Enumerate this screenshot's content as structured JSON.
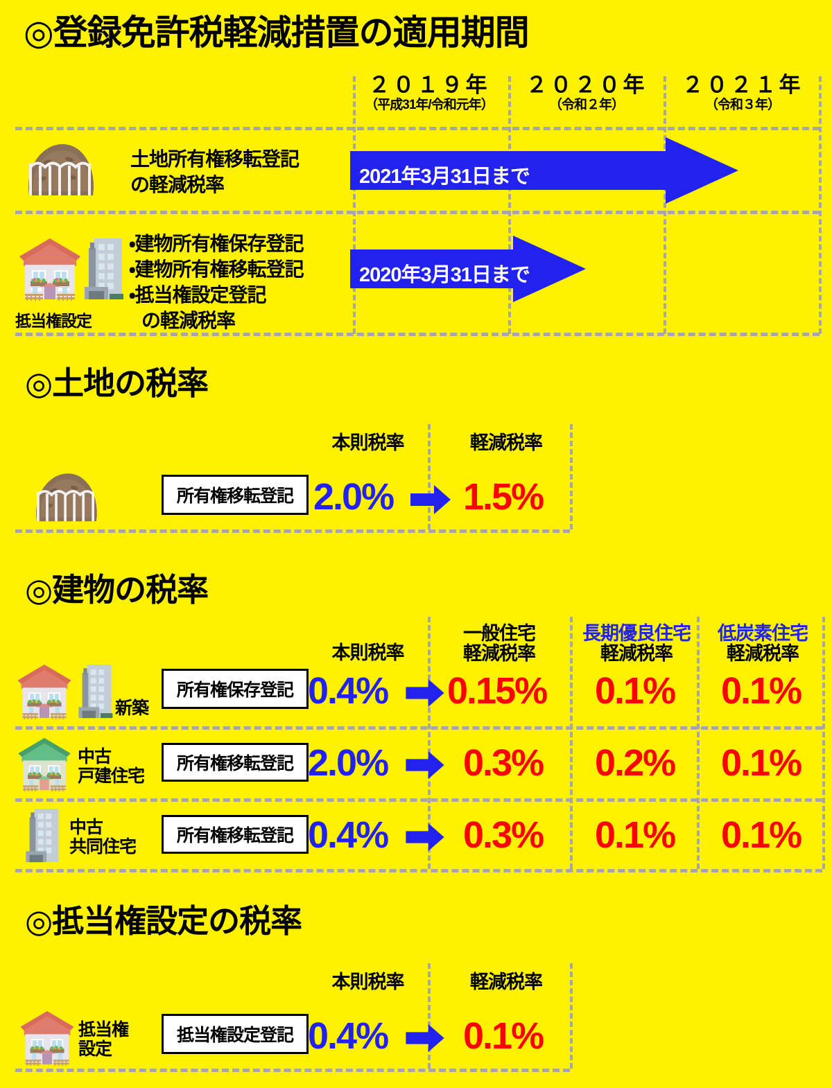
{
  "colors": {
    "background": "#FFF200",
    "arrow_blue": "#2222EE",
    "rate_red": "#FF0000",
    "divider_gray": "#A6A6A6",
    "text_black": "#000000"
  },
  "timeline": {
    "title": "◎登録免許税軽減措置の適用期間",
    "years": [
      {
        "year": "２０１９年",
        "era": "（平成31年/令和元年）"
      },
      {
        "year": "２０２０年",
        "era": "（令和２年）"
      },
      {
        "year": "２０２１年",
        "era": "（令和３年）"
      }
    ],
    "rows": [
      {
        "icon": "land-mound-icon",
        "label_line1": "土地所有権移転登記",
        "label_line2": "の軽減税率",
        "arrow_text": "2021年3月31日まで"
      },
      {
        "icon": "house-and-building-icon",
        "icon_caption": "抵当権設定",
        "bullets": [
          "・建物所有権保存登記",
          "・建物所有権移転登記",
          "・抵当権設定登記"
        ],
        "label_line2": "の軽減税率",
        "arrow_text": "2020年3月31日まで"
      }
    ]
  },
  "land": {
    "title": "◎土地の税率",
    "headers": {
      "standard": "本則税率",
      "reduced": "軽減税率"
    },
    "row": {
      "icon": "land-mound-icon",
      "registration": "所有権移転登記",
      "standard_rate": "2.0%",
      "reduced_rate": "1.5%"
    }
  },
  "building": {
    "title": "◎建物の税率",
    "headers": {
      "standard": "本則税率",
      "general_line1": "一般住宅",
      "general_line2": "軽減税率",
      "long_term_line1": "長期優良住宅",
      "long_term_line2": "軽減税率",
      "low_carbon_line1": "低炭素住宅",
      "low_carbon_line2": "軽減税率"
    },
    "rows": [
      {
        "icon": "new-house-and-building-icon",
        "label_line1": "新築",
        "label_line2": "",
        "registration": "所有権保存登記",
        "standard_rate": "0.4%",
        "general_rate": "0.15%",
        "long_term_rate": "0.1%",
        "low_carbon_rate": "0.1%"
      },
      {
        "icon": "used-detached-house-icon",
        "label_line1": "中古",
        "label_line2": "戸建住宅",
        "registration": "所有権移転登記",
        "standard_rate": "2.0%",
        "general_rate": "0.3%",
        "long_term_rate": "0.2%",
        "low_carbon_rate": "0.1%"
      },
      {
        "icon": "used-condominium-icon",
        "label_line1": "中古",
        "label_line2": "共同住宅",
        "registration": "所有権移転登記",
        "standard_rate": "0.4%",
        "general_rate": "0.3%",
        "long_term_rate": "0.1%",
        "low_carbon_rate": "0.1%"
      }
    ]
  },
  "mortgage": {
    "title": "◎抵当権設定の税率",
    "headers": {
      "standard": "本則税率",
      "reduced": "軽減税率"
    },
    "row": {
      "icon": "house-icon",
      "label_line1": "抵当権",
      "label_line2": "設定",
      "registration": "抵当権設定登記",
      "standard_rate": "0.4%",
      "reduced_rate": "0.1%"
    }
  }
}
